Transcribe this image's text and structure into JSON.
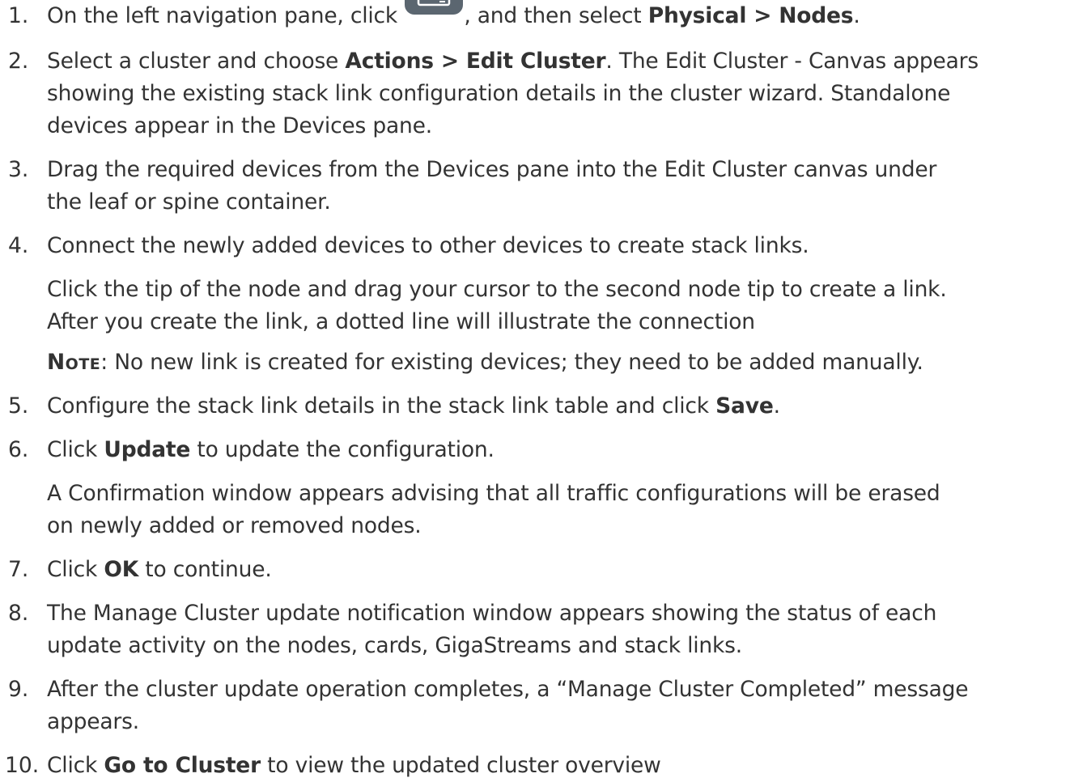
{
  "steps": [
    {
      "number": "1.",
      "prefix": "On the left navigation pane, click ",
      "icon": "inventory-icon",
      "middle": ", and then select ",
      "bold": "Physical > Nodes",
      "suffix": "."
    },
    {
      "number": "2.",
      "prefix": "Select a cluster and choose ",
      "bold": "Actions > Edit Cluster",
      "line1_suffix": ". The Edit Cluster - Canvas appears",
      "line2": "showing the existing stack link configuration details in the cluster wizard. Standalone",
      "line3": "devices appear in the Devices pane."
    },
    {
      "number": "3.",
      "line1": "Drag the required devices from the Devices pane into the Edit Cluster canvas under",
      "line2": "the leaf or spine container."
    },
    {
      "number": "4.",
      "line1": "Connect the newly added devices to other devices to create stack links.",
      "para_line1": "Click the tip of the node and drag your cursor to the second node tip to create a link.",
      "para_line2": "After you create the link, a dotted line will illustrate the connection",
      "note_label": "Note",
      "note_text": ": No new link is created for existing devices; they need to be added manually."
    },
    {
      "number": "5.",
      "prefix": "Configure the stack link details in the stack link table and click ",
      "bold": "Save",
      "suffix": "."
    },
    {
      "number": "6.",
      "prefix": "Click ",
      "bold": "Update",
      "suffix": " to update the configuration.",
      "para_line1": "A Confirmation window appears advising that all traffic configurations will be erased",
      "para_line2": "on newly added or removed nodes."
    },
    {
      "number": "7.",
      "prefix": "Click ",
      "bold": "OK",
      "suffix": " to continue."
    },
    {
      "number": "8.",
      "line1": "The Manage Cluster update notification window appears showing the status of each",
      "line2": "update activity on the nodes, cards, GigaStreams and stack links."
    },
    {
      "number": "9.",
      "line1": "After the cluster update operation completes, a “Manage Cluster Completed” message",
      "line2": "appears."
    },
    {
      "number": "10.",
      "prefix": "Click ",
      "bold": "Go to Cluster",
      "suffix": " to view the updated cluster overview"
    }
  ],
  "colors": {
    "text": "#333333",
    "icon_fill": "#5b6670"
  }
}
